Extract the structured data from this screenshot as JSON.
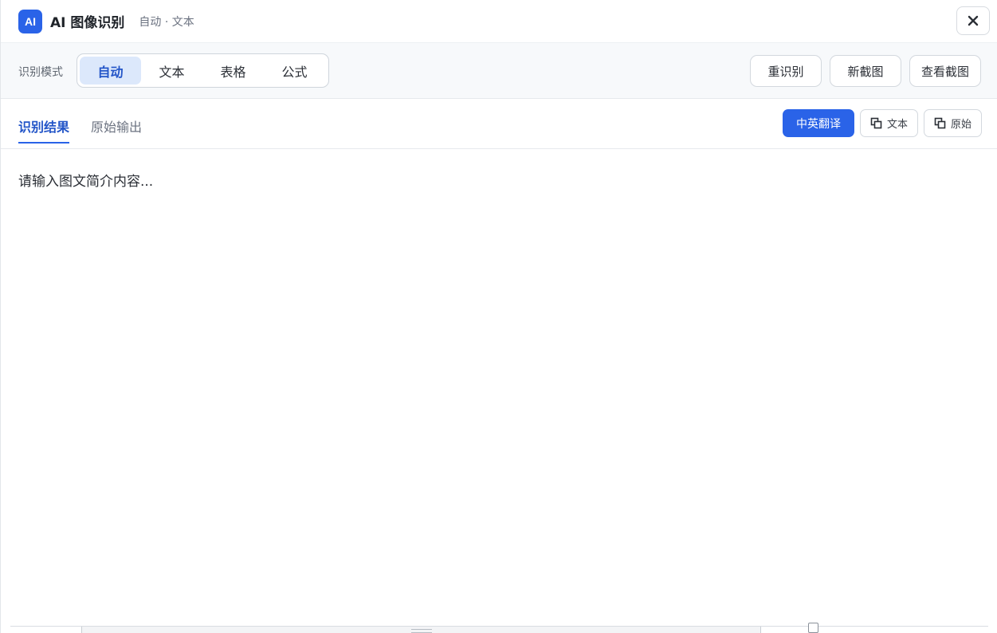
{
  "header": {
    "logo_text": "AI",
    "title": "AI 图像识别",
    "subtitle": "自动 · 文本"
  },
  "mode_bar": {
    "label": "识别模式",
    "modes": [
      {
        "label": "自动",
        "active": true
      },
      {
        "label": "文本",
        "active": false
      },
      {
        "label": "表格",
        "active": false
      },
      {
        "label": "公式",
        "active": false
      }
    ],
    "actions": {
      "rerecognize": "重识别",
      "new_capture": "新截图",
      "view_capture": "查看截图"
    }
  },
  "tabs": {
    "result": "识别结果",
    "raw_output": "原始输出",
    "active": "result"
  },
  "tab_actions": {
    "translate": "中英翻译",
    "copy_text": "文本",
    "copy_raw": "原始"
  },
  "content": {
    "placeholder": "请输入图文简介内容..."
  },
  "colors": {
    "accent": "#2a63e8",
    "active_segment_bg": "#dce8fb",
    "active_text": "#2456c8"
  }
}
